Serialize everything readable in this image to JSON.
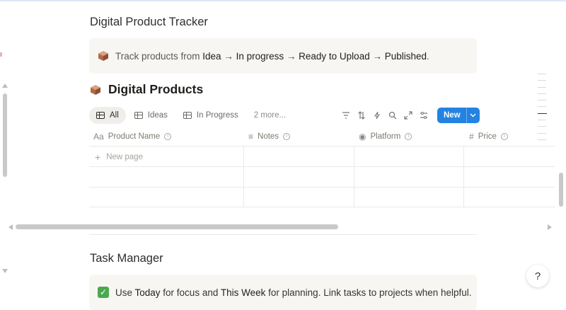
{
  "section1": {
    "title": "Digital Product Tracker",
    "callout": {
      "prefix": "Track products from ",
      "s1": "Idea",
      "arrow1": " → ",
      "s2": "In progress",
      "arrow2": " → ",
      "s3": "Ready to Upload",
      "arrow3": " → ",
      "s4": "Published",
      "suffix": "."
    }
  },
  "database": {
    "icon": "package-icon",
    "title": "Digital Products",
    "tabs": [
      {
        "label": "All"
      },
      {
        "label": "Ideas"
      },
      {
        "label": "In Progress"
      },
      {
        "label": "2 more..."
      }
    ],
    "toolbar": {
      "new_label": "New"
    },
    "columns": [
      {
        "icon": "Aa",
        "label": "Product Name"
      },
      {
        "icon": "≡",
        "label": "Notes"
      },
      {
        "icon": "◉",
        "label": "Platform"
      },
      {
        "icon": "#",
        "label": "Price"
      }
    ],
    "new_page_label": "New page"
  },
  "section2": {
    "title": "Task Manager",
    "callout": {
      "prefix": "Use ",
      "b1": "Today",
      "mid": " for focus and ",
      "b2": "This Week",
      "suffix": " for planning. Link tasks to projects when helpful."
    }
  },
  "help_button": {
    "label": "?"
  },
  "colors": {
    "accent": "#2383e2",
    "callout_bg": "#f7f6f3",
    "check": "#4aa94f"
  }
}
